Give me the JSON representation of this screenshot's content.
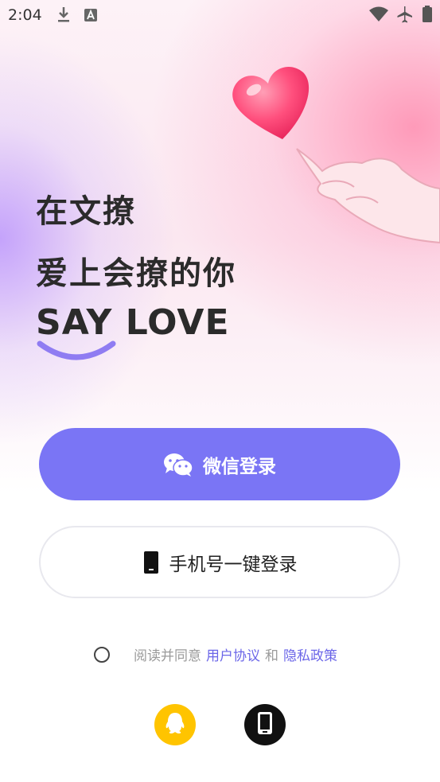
{
  "status_bar": {
    "time": "2:04"
  },
  "headline": {
    "line1": "在文撩",
    "line2": "爱上会撩的你",
    "slogan": "SAY LOVE"
  },
  "buttons": {
    "wechat_login": "微信登录",
    "phone_login": "手机号一键登录"
  },
  "agreement": {
    "prefix": "阅读并同意",
    "user_agreement": "用户协议",
    "and": "和",
    "privacy_policy": "隐私政策",
    "checked": false
  },
  "alternate_logins": [
    {
      "icon": "qq-penguin-icon",
      "color": "#ffc400"
    },
    {
      "icon": "mobile-phone-icon",
      "color": "#111111"
    }
  ],
  "colors": {
    "primary": "#7a75f5",
    "link": "#6b66e8"
  }
}
